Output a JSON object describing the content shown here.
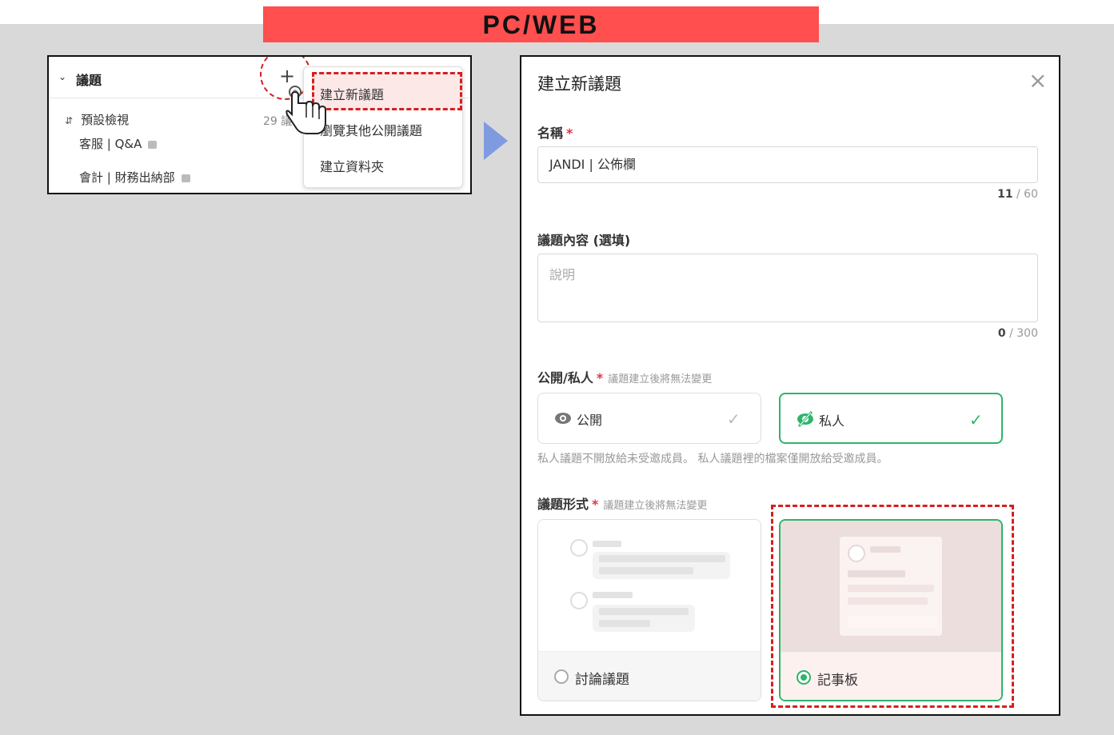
{
  "banner": {
    "label": "PC/WEB"
  },
  "sidebar": {
    "section_title": "議題",
    "rows": [
      {
        "label": "預設檢視",
        "count": "29 議"
      },
      {
        "label": "客服 | Q&A"
      },
      {
        "label": "會計 | 財務出納部"
      }
    ],
    "add_symbol": "+",
    "menu": [
      {
        "label": "建立新議題"
      },
      {
        "label": "瀏覽其他公開議題"
      },
      {
        "label": "建立資料夾"
      }
    ]
  },
  "dialog": {
    "title": "建立新議題",
    "close_symbol": "×",
    "name_label": "名稱",
    "required_mark": "*",
    "name_value": "JANDI | 公佈欄",
    "name_count": "11",
    "name_max": "/ 60",
    "content_label": "議題內容 (選填)",
    "content_placeholder": "說明",
    "content_count": "0",
    "content_max": "/ 300",
    "visibility_label": "公開/私人",
    "visibility_hint": "議題建立後將無法變更",
    "public_label": "公開",
    "private_label": "私人",
    "visibility_note": "私人議題不開放給未受邀成員。 私人議題裡的檔案僅開放給受邀成員。",
    "type_label": "議題形式",
    "type_hint": "議題建立後將無法變更",
    "discussion_label": "討論議題",
    "board_label": "記事板",
    "selected_visibility": "私人",
    "selected_type": "記事板"
  },
  "colors": {
    "accent_green": "#2db56a",
    "highlight_red": "#d42020",
    "banner_red": "#ff4f4f",
    "arrow_blue": "#7f9be0"
  }
}
